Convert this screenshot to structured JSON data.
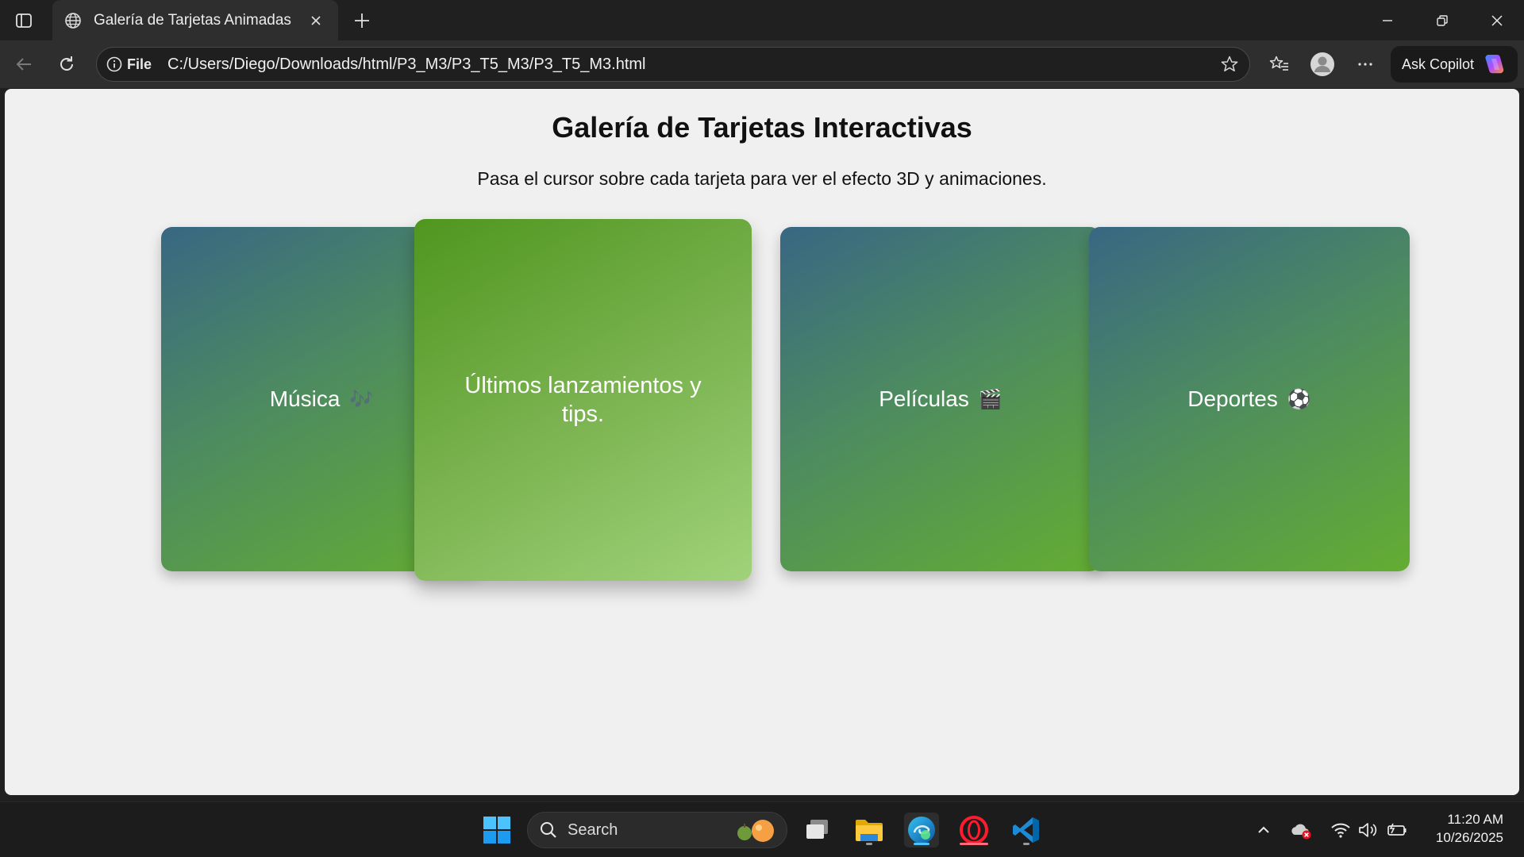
{
  "browser": {
    "tab_title": "Galería de Tarjetas Animadas",
    "address_prefix": "File",
    "url": "C:/Users/Diego/Downloads/html/P3_M3/P3_T5_M3/P3_T5_M3.html",
    "copilot_label": "Ask Copilot"
  },
  "page": {
    "title": "Galería de Tarjetas Interactivas",
    "subtitle": "Pasa el cursor sobre cada tarjeta para ver el efecto 3D y animaciones.",
    "cards": [
      {
        "label": "Música",
        "emoji": "🎶"
      },
      {
        "label": "Últimos lanzamientos y tips.",
        "emoji": ""
      },
      {
        "label": "Películas",
        "emoji": "🎬"
      },
      {
        "label": "Deportes",
        "emoji": "⚽"
      }
    ]
  },
  "taskbar": {
    "search_placeholder": "Search",
    "time": "11:20 AM",
    "date": "10/26/2025"
  }
}
